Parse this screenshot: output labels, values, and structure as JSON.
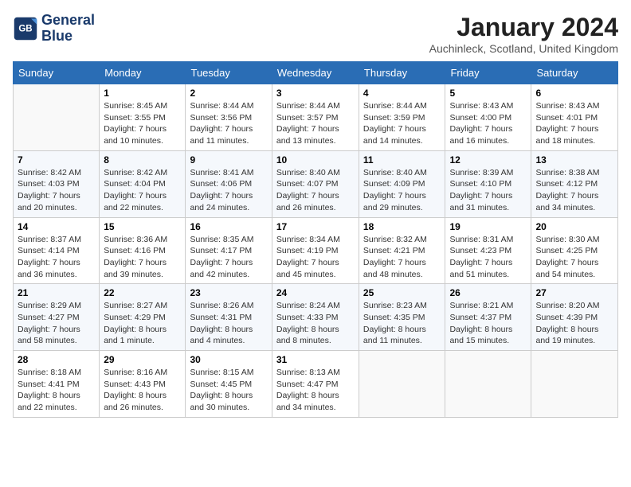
{
  "header": {
    "logo_line1": "General",
    "logo_line2": "Blue",
    "month_title": "January 2024",
    "location": "Auchinleck, Scotland, United Kingdom"
  },
  "days_of_week": [
    "Sunday",
    "Monday",
    "Tuesday",
    "Wednesday",
    "Thursday",
    "Friday",
    "Saturday"
  ],
  "weeks": [
    [
      {
        "num": "",
        "sunrise": "",
        "sunset": "",
        "daylight": ""
      },
      {
        "num": "1",
        "sunrise": "Sunrise: 8:45 AM",
        "sunset": "Sunset: 3:55 PM",
        "daylight": "Daylight: 7 hours and 10 minutes."
      },
      {
        "num": "2",
        "sunrise": "Sunrise: 8:44 AM",
        "sunset": "Sunset: 3:56 PM",
        "daylight": "Daylight: 7 hours and 11 minutes."
      },
      {
        "num": "3",
        "sunrise": "Sunrise: 8:44 AM",
        "sunset": "Sunset: 3:57 PM",
        "daylight": "Daylight: 7 hours and 13 minutes."
      },
      {
        "num": "4",
        "sunrise": "Sunrise: 8:44 AM",
        "sunset": "Sunset: 3:59 PM",
        "daylight": "Daylight: 7 hours and 14 minutes."
      },
      {
        "num": "5",
        "sunrise": "Sunrise: 8:43 AM",
        "sunset": "Sunset: 4:00 PM",
        "daylight": "Daylight: 7 hours and 16 minutes."
      },
      {
        "num": "6",
        "sunrise": "Sunrise: 8:43 AM",
        "sunset": "Sunset: 4:01 PM",
        "daylight": "Daylight: 7 hours and 18 minutes."
      }
    ],
    [
      {
        "num": "7",
        "sunrise": "Sunrise: 8:42 AM",
        "sunset": "Sunset: 4:03 PM",
        "daylight": "Daylight: 7 hours and 20 minutes."
      },
      {
        "num": "8",
        "sunrise": "Sunrise: 8:42 AM",
        "sunset": "Sunset: 4:04 PM",
        "daylight": "Daylight: 7 hours and 22 minutes."
      },
      {
        "num": "9",
        "sunrise": "Sunrise: 8:41 AM",
        "sunset": "Sunset: 4:06 PM",
        "daylight": "Daylight: 7 hours and 24 minutes."
      },
      {
        "num": "10",
        "sunrise": "Sunrise: 8:40 AM",
        "sunset": "Sunset: 4:07 PM",
        "daylight": "Daylight: 7 hours and 26 minutes."
      },
      {
        "num": "11",
        "sunrise": "Sunrise: 8:40 AM",
        "sunset": "Sunset: 4:09 PM",
        "daylight": "Daylight: 7 hours and 29 minutes."
      },
      {
        "num": "12",
        "sunrise": "Sunrise: 8:39 AM",
        "sunset": "Sunset: 4:10 PM",
        "daylight": "Daylight: 7 hours and 31 minutes."
      },
      {
        "num": "13",
        "sunrise": "Sunrise: 8:38 AM",
        "sunset": "Sunset: 4:12 PM",
        "daylight": "Daylight: 7 hours and 34 minutes."
      }
    ],
    [
      {
        "num": "14",
        "sunrise": "Sunrise: 8:37 AM",
        "sunset": "Sunset: 4:14 PM",
        "daylight": "Daylight: 7 hours and 36 minutes."
      },
      {
        "num": "15",
        "sunrise": "Sunrise: 8:36 AM",
        "sunset": "Sunset: 4:16 PM",
        "daylight": "Daylight: 7 hours and 39 minutes."
      },
      {
        "num": "16",
        "sunrise": "Sunrise: 8:35 AM",
        "sunset": "Sunset: 4:17 PM",
        "daylight": "Daylight: 7 hours and 42 minutes."
      },
      {
        "num": "17",
        "sunrise": "Sunrise: 8:34 AM",
        "sunset": "Sunset: 4:19 PM",
        "daylight": "Daylight: 7 hours and 45 minutes."
      },
      {
        "num": "18",
        "sunrise": "Sunrise: 8:32 AM",
        "sunset": "Sunset: 4:21 PM",
        "daylight": "Daylight: 7 hours and 48 minutes."
      },
      {
        "num": "19",
        "sunrise": "Sunrise: 8:31 AM",
        "sunset": "Sunset: 4:23 PM",
        "daylight": "Daylight: 7 hours and 51 minutes."
      },
      {
        "num": "20",
        "sunrise": "Sunrise: 8:30 AM",
        "sunset": "Sunset: 4:25 PM",
        "daylight": "Daylight: 7 hours and 54 minutes."
      }
    ],
    [
      {
        "num": "21",
        "sunrise": "Sunrise: 8:29 AM",
        "sunset": "Sunset: 4:27 PM",
        "daylight": "Daylight: 7 hours and 58 minutes."
      },
      {
        "num": "22",
        "sunrise": "Sunrise: 8:27 AM",
        "sunset": "Sunset: 4:29 PM",
        "daylight": "Daylight: 8 hours and 1 minute."
      },
      {
        "num": "23",
        "sunrise": "Sunrise: 8:26 AM",
        "sunset": "Sunset: 4:31 PM",
        "daylight": "Daylight: 8 hours and 4 minutes."
      },
      {
        "num": "24",
        "sunrise": "Sunrise: 8:24 AM",
        "sunset": "Sunset: 4:33 PM",
        "daylight": "Daylight: 8 hours and 8 minutes."
      },
      {
        "num": "25",
        "sunrise": "Sunrise: 8:23 AM",
        "sunset": "Sunset: 4:35 PM",
        "daylight": "Daylight: 8 hours and 11 minutes."
      },
      {
        "num": "26",
        "sunrise": "Sunrise: 8:21 AM",
        "sunset": "Sunset: 4:37 PM",
        "daylight": "Daylight: 8 hours and 15 minutes."
      },
      {
        "num": "27",
        "sunrise": "Sunrise: 8:20 AM",
        "sunset": "Sunset: 4:39 PM",
        "daylight": "Daylight: 8 hours and 19 minutes."
      }
    ],
    [
      {
        "num": "28",
        "sunrise": "Sunrise: 8:18 AM",
        "sunset": "Sunset: 4:41 PM",
        "daylight": "Daylight: 8 hours and 22 minutes."
      },
      {
        "num": "29",
        "sunrise": "Sunrise: 8:16 AM",
        "sunset": "Sunset: 4:43 PM",
        "daylight": "Daylight: 8 hours and 26 minutes."
      },
      {
        "num": "30",
        "sunrise": "Sunrise: 8:15 AM",
        "sunset": "Sunset: 4:45 PM",
        "daylight": "Daylight: 8 hours and 30 minutes."
      },
      {
        "num": "31",
        "sunrise": "Sunrise: 8:13 AM",
        "sunset": "Sunset: 4:47 PM",
        "daylight": "Daylight: 8 hours and 34 minutes."
      },
      {
        "num": "",
        "sunrise": "",
        "sunset": "",
        "daylight": ""
      },
      {
        "num": "",
        "sunrise": "",
        "sunset": "",
        "daylight": ""
      },
      {
        "num": "",
        "sunrise": "",
        "sunset": "",
        "daylight": ""
      }
    ]
  ]
}
